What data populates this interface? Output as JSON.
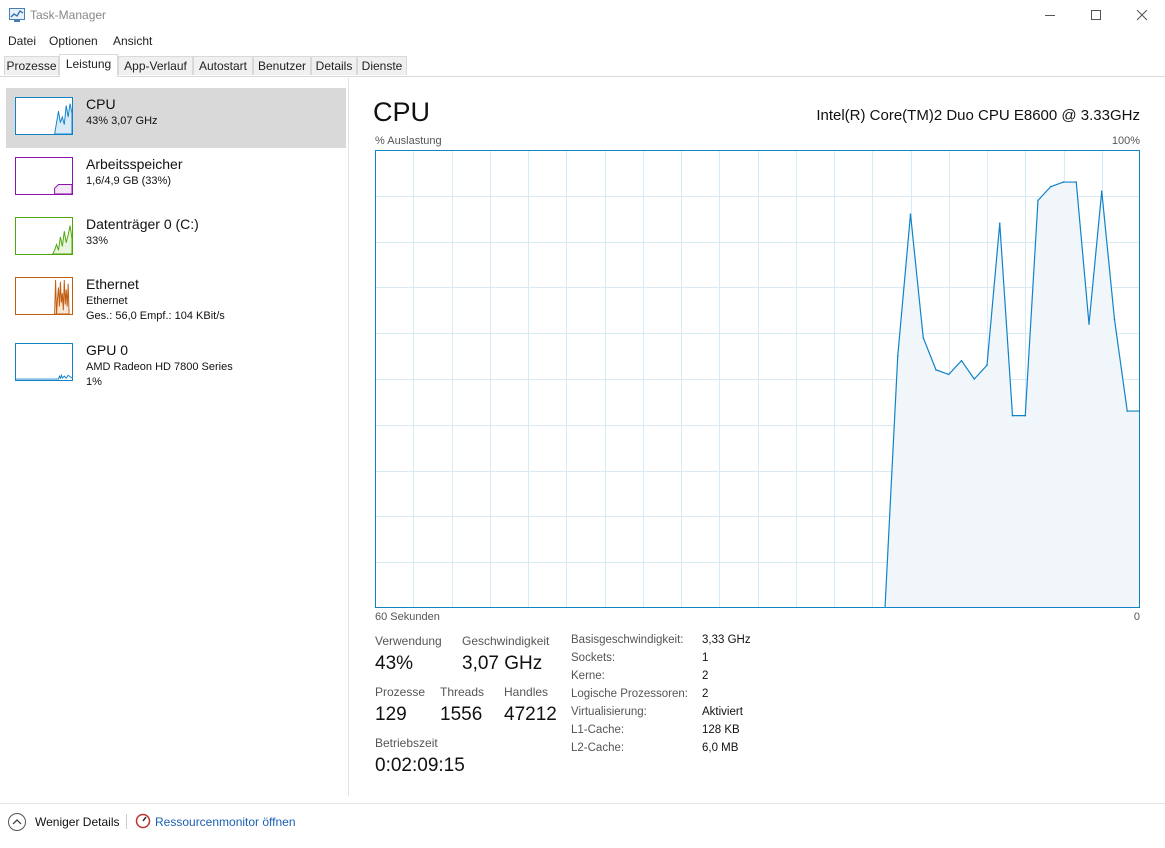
{
  "window": {
    "title": "Task-Manager"
  },
  "menu": [
    "Datei",
    "Optionen",
    "Ansicht"
  ],
  "tabs": [
    "Prozesse",
    "Leistung",
    "App-Verlauf",
    "Autostart",
    "Benutzer",
    "Details",
    "Dienste"
  ],
  "active_tab": "Leistung",
  "sidebar": {
    "items": [
      {
        "name": "CPU",
        "sub1": "43%  3,07 GHz",
        "sub2": "",
        "color": "#1183c9",
        "selected": true
      },
      {
        "name": "Arbeitsspeicher",
        "sub1": "1,6/4,9 GB (33%)",
        "sub2": "",
        "color": "#8b12ae",
        "selected": false
      },
      {
        "name": "Datenträger 0 (C:)",
        "sub1": "33%",
        "sub2": "",
        "color": "#4da60c",
        "selected": false
      },
      {
        "name": "Ethernet",
        "sub1": "Ethernet",
        "sub2": "Ges.: 56,0  Empf.: 104 KBit/s",
        "color": "#c25d0f",
        "selected": false
      },
      {
        "name": "GPU 0",
        "sub1": "AMD Radeon HD 7800 Series",
        "sub2": "1%",
        "color": "#1183c9",
        "selected": false
      }
    ]
  },
  "main": {
    "title": "CPU",
    "model": "Intel(R) Core(TM)2 Duo CPU E8600 @ 3.33GHz",
    "graph_label_left": "% Auslastung",
    "graph_label_right": "100%",
    "graph_axis_left": "60 Sekunden",
    "graph_axis_right": "0",
    "stats": {
      "usage_label": "Verwendung",
      "usage_value": "43%",
      "speed_label": "Geschwindigkeit",
      "speed_value": "3,07 GHz",
      "processes_label": "Prozesse",
      "processes_value": "129",
      "threads_label": "Threads",
      "threads_value": "1556",
      "handles_label": "Handles",
      "handles_value": "47212",
      "uptime_label": "Betriebszeit",
      "uptime_value": "0:02:09:15"
    },
    "details": [
      {
        "key": "Basisgeschwindigkeit:",
        "value": "3,33 GHz"
      },
      {
        "key": "Sockets:",
        "value": "1"
      },
      {
        "key": "Kerne:",
        "value": "2"
      },
      {
        "key": "Logische Prozessoren:",
        "value": "2"
      },
      {
        "key": "Virtualisierung:",
        "value": "Aktiviert"
      },
      {
        "key": "L1-Cache:",
        "value": "128 KB"
      },
      {
        "key": "L2-Cache:",
        "value": "6,0 MB"
      }
    ]
  },
  "footer": {
    "less_details": "Weniger Details",
    "resource_monitor": "Ressourcenmonitor öffnen"
  },
  "chart_data": {
    "type": "area",
    "xlabel": "60 Sekunden",
    "ylabel": "% Auslastung",
    "ylim": [
      0,
      100
    ],
    "xlim": [
      60,
      0
    ],
    "grid": true,
    "x": [
      20,
      19,
      18,
      17,
      16,
      15,
      14,
      13,
      12,
      11,
      10,
      9,
      8,
      7,
      6,
      5,
      4,
      3,
      2,
      1,
      0
    ],
    "values": [
      0,
      55,
      86,
      59,
      52,
      51,
      54,
      50,
      53,
      84,
      42,
      42,
      89,
      92,
      93,
      93,
      62,
      91,
      63,
      43,
      43
    ],
    "color": "#1183c9"
  }
}
